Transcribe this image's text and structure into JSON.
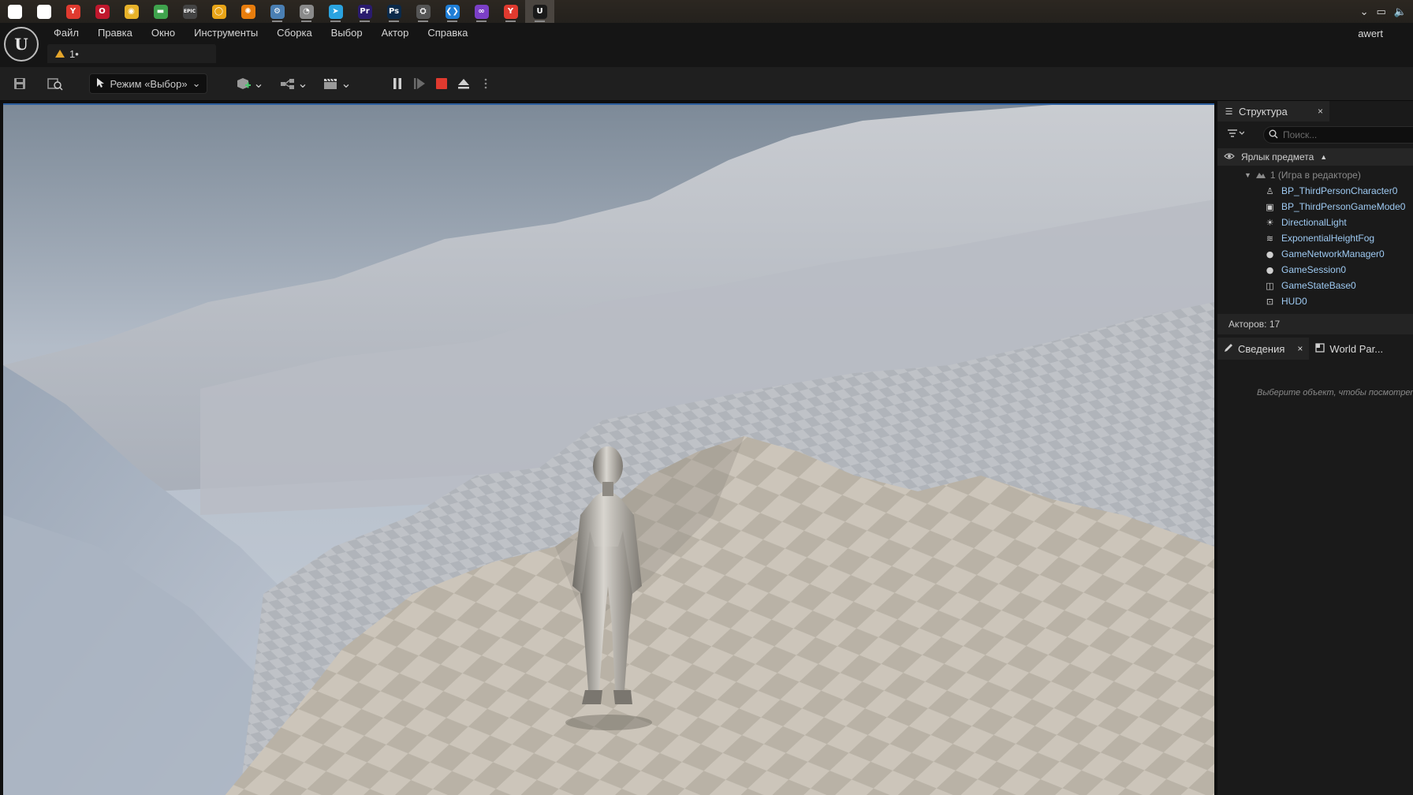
{
  "taskbar": {
    "icons": [
      {
        "name": "windows-start-icon",
        "glyph": "⊞",
        "color": "#ffffff"
      },
      {
        "name": "search-icon",
        "glyph": "⌕",
        "color": "#ffffff"
      },
      {
        "name": "yandex-browser-icon",
        "glyph": "Y",
        "color": "#e03a2f"
      },
      {
        "name": "opera-icon",
        "glyph": "O",
        "color": "#c0182d"
      },
      {
        "name": "chrome-icon",
        "glyph": "◉",
        "color": "#e8b229"
      },
      {
        "name": "color-app-icon",
        "glyph": "▬",
        "color": "#3fa34d"
      },
      {
        "name": "epic-games-icon",
        "glyph": "EPIC",
        "color": "#444444"
      },
      {
        "name": "circle-app-icon",
        "glyph": "◯",
        "color": "#e8a417"
      },
      {
        "name": "blender-icon",
        "glyph": "✺",
        "color": "#e87d0d"
      },
      {
        "name": "steam-icon",
        "glyph": "⚙",
        "color": "#4a7fb3"
      },
      {
        "name": "speedometer-icon",
        "glyph": "◔",
        "color": "#8a8a8a"
      },
      {
        "name": "telegram-icon",
        "glyph": "➤",
        "color": "#2aa3e0"
      },
      {
        "name": "premiere-pro-icon",
        "glyph": "Pr",
        "color": "#2a1b6e"
      },
      {
        "name": "photoshop-icon",
        "glyph": "Ps",
        "color": "#0b2a4a"
      },
      {
        "name": "network-app-icon",
        "glyph": "⛭",
        "color": "#555555"
      },
      {
        "name": "vscode-icon",
        "glyph": "❮❯",
        "color": "#1f7ed6"
      },
      {
        "name": "visual-studio-icon",
        "glyph": "∞",
        "color": "#7b3fc6"
      },
      {
        "name": "yandex-icon",
        "glyph": "Y",
        "color": "#e03a2f"
      },
      {
        "name": "unreal-engine-taskbar-icon",
        "glyph": "U",
        "color": "#1a1a1a"
      }
    ],
    "tray": {
      "chevron": "⌄",
      "network": "▭",
      "volume": "🔈"
    }
  },
  "menubar": {
    "items": [
      "Файл",
      "Правка",
      "Окно",
      "Инструменты",
      "Сборка",
      "Выбор",
      "Актор",
      "Справка"
    ],
    "level_tab": "1•",
    "user": "awert"
  },
  "toolbar": {
    "mode_label": "Режим «Выбор»"
  },
  "outliner": {
    "title": "Структура",
    "close": "×",
    "search_placeholder": "Поиск...",
    "column_label": "Ярлык предмета",
    "root_label": "1 (Игра в редакторе)",
    "items": [
      {
        "label": "BP_ThirdPersonCharacter0",
        "icon": "person-icon"
      },
      {
        "label": "BP_ThirdPersonGameMode0",
        "icon": "gamemode-icon"
      },
      {
        "label": "DirectionalLight",
        "icon": "sun-icon"
      },
      {
        "label": "ExponentialHeightFog",
        "icon": "fog-icon"
      },
      {
        "label": "GameNetworkManager0",
        "icon": "actor-icon"
      },
      {
        "label": "GameSession0",
        "icon": "actor-icon"
      },
      {
        "label": "GameStateBase0",
        "icon": "gamestate-icon"
      },
      {
        "label": "HUD0",
        "icon": "hud-icon"
      }
    ],
    "actors_count": "Акторов: 17"
  },
  "details": {
    "tab_label": "Сведения",
    "close": "×",
    "world_tab_label": "World Par...",
    "hint": "Выберите объект, чтобы посмотреть"
  },
  "colors": {
    "accent_blue": "#2c5e9e",
    "stop_red": "#e03a2f",
    "tree_text": "#9ecaf2"
  }
}
